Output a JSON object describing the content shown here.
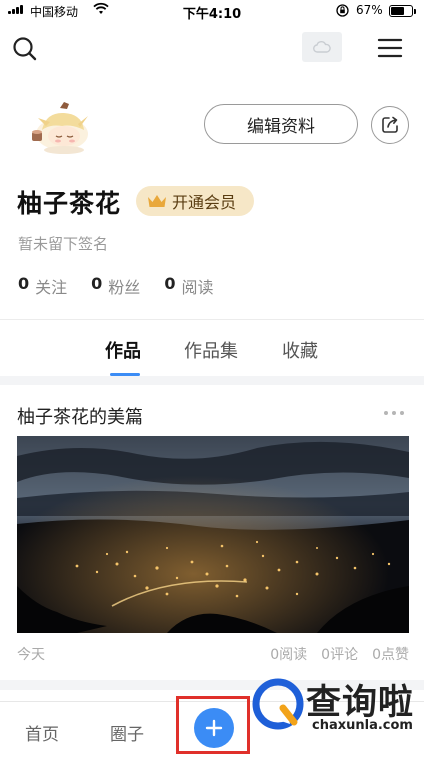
{
  "status_bar": {
    "carrier": "中国移动",
    "time": "下午4:10",
    "battery_percent": "67%",
    "battery_level": 0.67
  },
  "header": {
    "search_icon": "search-icon",
    "menu_icon": "hamburger-menu-icon"
  },
  "profile": {
    "edit_label": "编辑资料",
    "username": "柚子茶花",
    "vip_label": "开通会员",
    "signature": "暂未留下签名",
    "stats": [
      {
        "value": "0",
        "label": "关注"
      },
      {
        "value": "0",
        "label": "粉丝"
      },
      {
        "value": "0",
        "label": "阅读"
      }
    ]
  },
  "tabs": [
    {
      "label": "作品",
      "active": true
    },
    {
      "label": "作品集",
      "active": false
    },
    {
      "label": "收藏",
      "active": false
    }
  ],
  "articles": [
    {
      "title": "柚子茶花的美篇",
      "date": "今天",
      "reads": "0阅读",
      "comments": "0评论",
      "likes": "0点赞"
    }
  ],
  "bottom_nav": {
    "items": [
      {
        "label": "首页"
      },
      {
        "label": "圈子"
      }
    ],
    "add_icon": "plus-icon"
  },
  "watermark": {
    "title": "查询啦",
    "url": "chaxunla.com"
  },
  "colors": {
    "accent": "#3b8cf5",
    "vip_bg": "#f6e7c7",
    "highlight": "#e0302a"
  }
}
